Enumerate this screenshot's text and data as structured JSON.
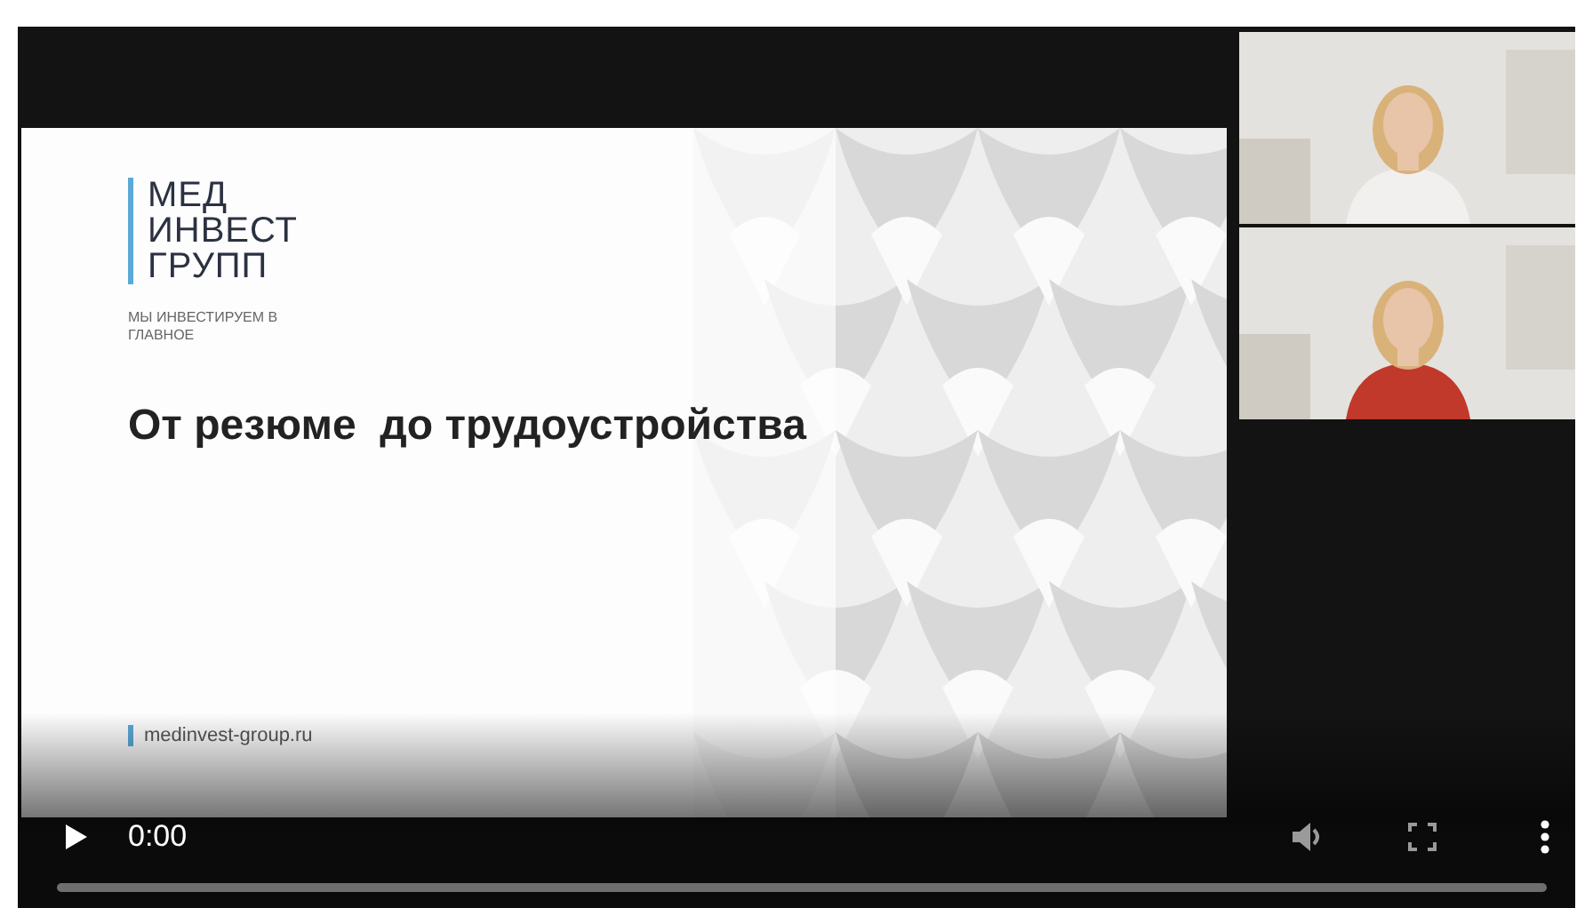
{
  "slide": {
    "logo_lines": [
      "МЕД",
      "ИНВЕСТ",
      "ГРУПП"
    ],
    "tagline": "МЫ ИНВЕСТИРУЕМ В ГЛАВНОЕ",
    "title": "От резюме  до трудоустройства",
    "website": "medinvest-group.ru"
  },
  "controls": {
    "time": "0:00",
    "progress": {
      "level": 0
    }
  }
}
